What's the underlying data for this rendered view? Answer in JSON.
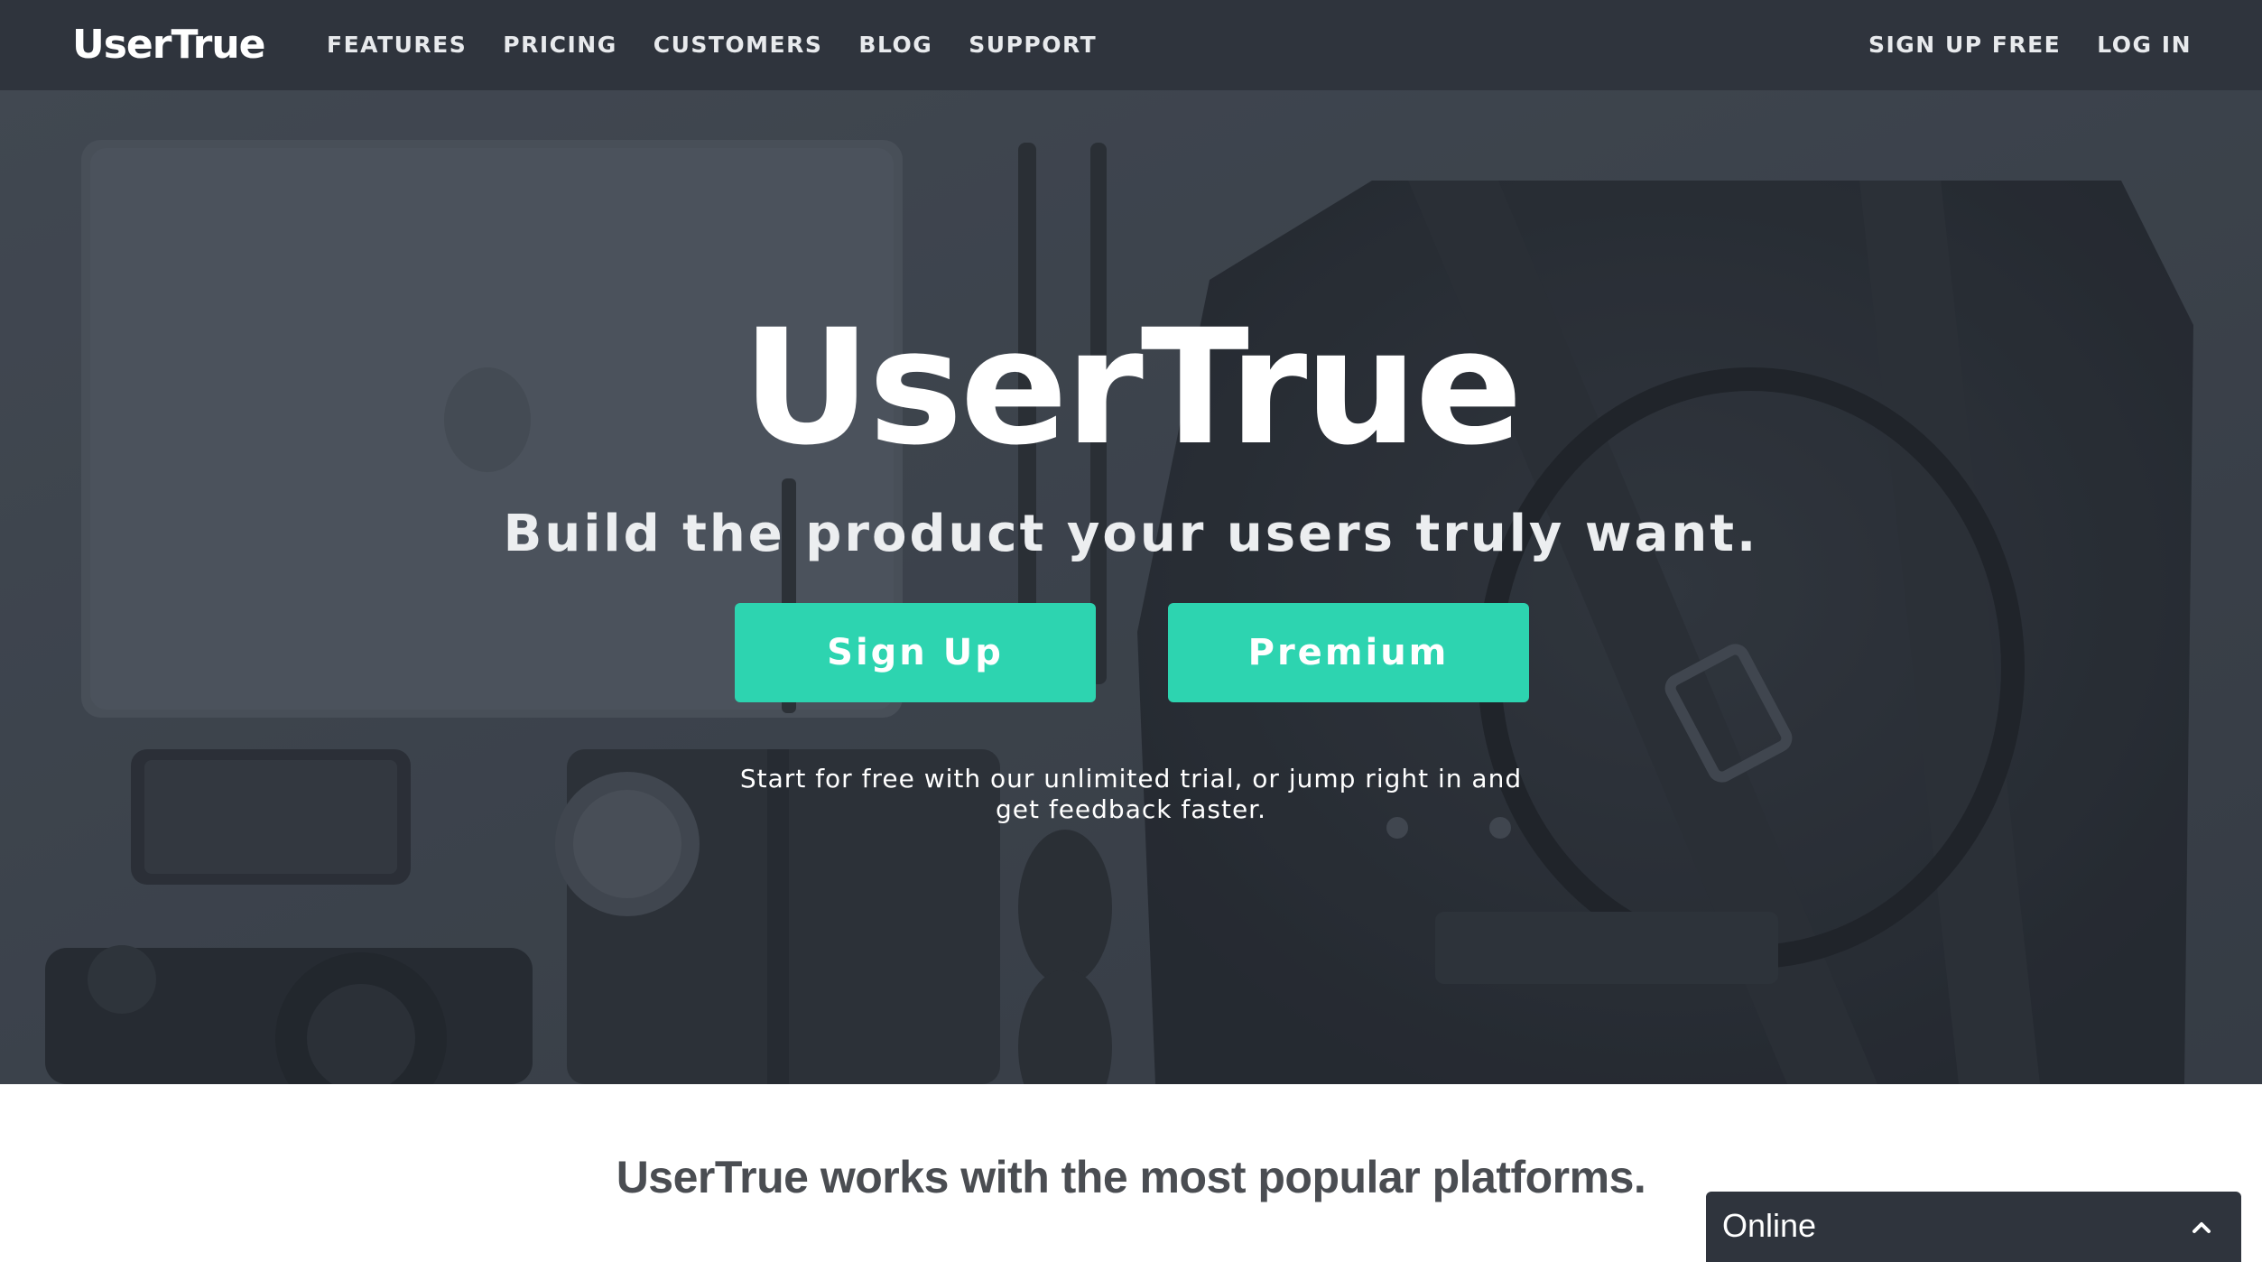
{
  "navbar": {
    "brand": "UserTrue",
    "left_links": [
      "FEATURES",
      "PRICING",
      "CUSTOMERS",
      "BLOG",
      "SUPPORT"
    ],
    "right_links": [
      "SIGN UP FREE",
      "LOG IN"
    ],
    "background_color": "#2f343d"
  },
  "hero": {
    "title": "UserTrue",
    "tagline": "Build the product your users truly want.",
    "signup_button": "Sign Up",
    "premium_button": "Premium",
    "note": "Start for free with our unlimited trial, or jump right in and get feedback faster.",
    "button_color": "#2dd4b0",
    "background_image": "desk flatlay with laptop, pens, phone, camera, sunglasses and leather backpack"
  },
  "platforms": {
    "heading": "UserTrue works with the most popular platforms."
  },
  "chat": {
    "status": "Online",
    "toggle_icon": "chevron-up-icon"
  }
}
